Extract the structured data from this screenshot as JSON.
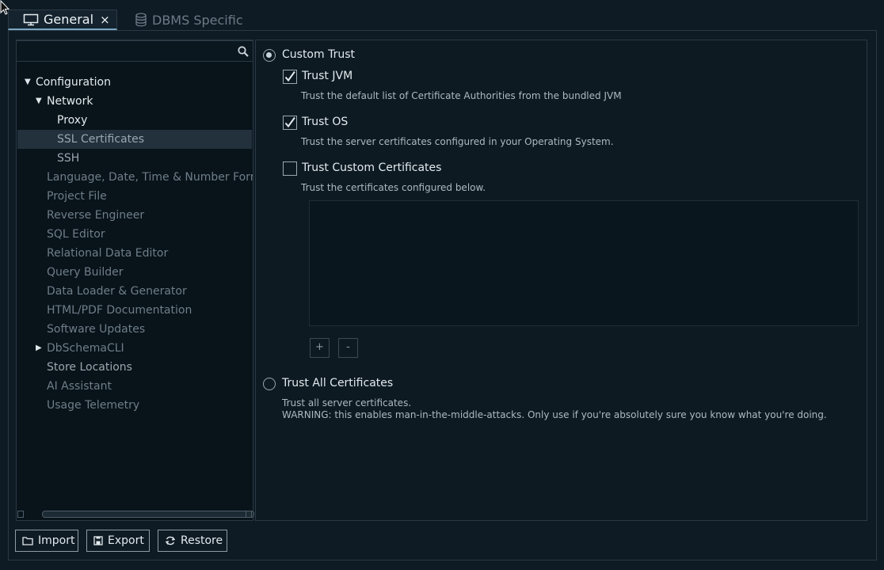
{
  "tabs": [
    {
      "label": "General",
      "close": "×"
    },
    {
      "label": "DBMS Specific"
    }
  ],
  "search": {
    "value": "",
    "placeholder": ""
  },
  "tree": {
    "configuration": "Configuration",
    "network": "Network",
    "proxy": "Proxy",
    "ssl_certificates": "SSL Certificates",
    "ssh": "SSH",
    "language": "Language, Date, Time & Number Formats",
    "project_file": "Project File",
    "reverse_engineer": "Reverse Engineer",
    "sql_editor": "SQL Editor",
    "relational_data_editor": "Relational Data Editor",
    "query_builder": "Query Builder",
    "data_loader": "Data Loader & Generator",
    "html_pdf": "HTML/PDF Documentation",
    "software_updates": "Software Updates",
    "dbschemacli": "DbSchemaCLI",
    "store_locations": "Store Locations",
    "ai_assistant": "AI Assistant",
    "usage_telemetry": "Usage Telemetry"
  },
  "settings": {
    "custom_trust": "Custom Trust",
    "trust_jvm": "Trust JVM",
    "trust_jvm_desc": "Trust the default list of Certificate Authorities from the bundled JVM",
    "trust_os": "Trust OS",
    "trust_os_desc": "Trust the server certificates configured in your Operating System.",
    "trust_custom": "Trust Custom Certificates",
    "trust_custom_desc": "Trust the certificates configured below.",
    "add": "+",
    "remove": "-",
    "trust_all": "Trust All Certificates",
    "trust_all_desc1": "Trust all server certificates.",
    "trust_all_desc2": "WARNING: this enables man-in-the-middle-attacks. Only use if you're absolutely sure you know what you're doing."
  },
  "state": {
    "custom_trust": true,
    "trust_jvm": true,
    "trust_os": true,
    "trust_custom": false,
    "trust_all": false
  },
  "buttons": {
    "import": "Import",
    "export": "Export",
    "restore": "Restore"
  },
  "icons": {
    "general_tab": "monitor-icon",
    "dbms_tab": "database-icon",
    "search": "search-icon",
    "import": "folder-icon",
    "export": "save-icon",
    "restore": "refresh-icon"
  },
  "colors": {
    "background": "#0f1b24",
    "selection": "#22313c",
    "accent": "#7aa6c2"
  }
}
